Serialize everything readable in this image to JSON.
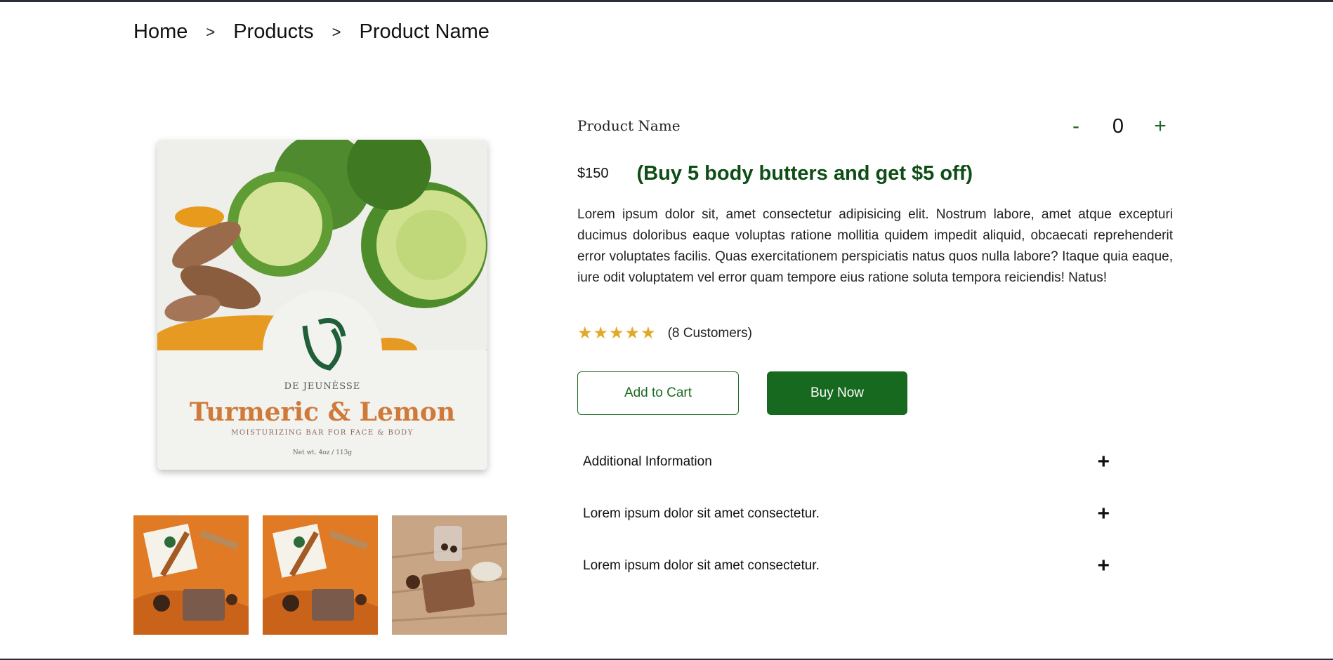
{
  "breadcrumb": {
    "home": "Home",
    "products": "Products",
    "current": "Product Name",
    "separator": ">"
  },
  "product": {
    "name": "Product Name",
    "price": "$150",
    "promo": "(Buy 5 body butters and get $5 off)",
    "description": "Lorem ipsum dolor sit, amet consectetur adipisicing elit. Nostrum labore, amet atque excepturi ducimus doloribus eaque voluptas ratione mollitia quidem impedit aliquid, obcaecati reprehenderit error voluptates facilis. Quas exercitationem perspiciatis natus quos nulla labore? Itaque quia eaque, iure odit voluptatem vel error quam tempore eius ratione soluta tempora reiciendis! Natus!",
    "rating": 5,
    "reviews": "(8 Customers)"
  },
  "image_label": {
    "brand": "DE JEUNÈSSE",
    "title": "Turmeric & Lemon",
    "subtitle": "MOISTURIZING BAR FOR FACE & BODY",
    "weight": "Net wt. 4oz / 113g"
  },
  "quantity": {
    "minus": "-",
    "value": "0",
    "plus": "+"
  },
  "actions": {
    "add_to_cart": "Add to Cart",
    "buy_now": "Buy Now"
  },
  "accordion": [
    {
      "label": "Additional Information",
      "icon": "+"
    },
    {
      "label": "Lorem ipsum dolor sit amet consectetur.",
      "icon": "+"
    },
    {
      "label": "Lorem ipsum dolor sit amet consectetur.",
      "icon": "+"
    }
  ],
  "colors": {
    "accent": "#16691e",
    "promo": "#0f4d16",
    "star": "#e0a92a",
    "border": "#2a2e3a"
  }
}
